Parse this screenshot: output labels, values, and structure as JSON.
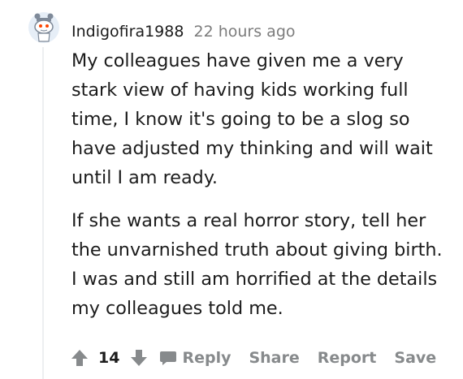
{
  "comment": {
    "username": "Indigofira1988",
    "timestamp": "22 hours ago",
    "paragraphs": [
      "My colleagues have given me a very stark view of having kids working full time, I know it's going to be a slog so have adjusted my thinking and will wait until I am ready.",
      "If she wants a real horror story, tell her the unvarnished truth about giving birth. I was and still am horrified at the details my colleagues told me."
    ],
    "score": "14",
    "actions": {
      "reply": "Reply",
      "share": "Share",
      "report": "Report",
      "save": "Save"
    }
  },
  "icons": {
    "avatar": "snoo-avatar-icon",
    "upvote": "upvote-arrow-icon",
    "downvote": "downvote-arrow-icon",
    "reply": "chat-bubble-icon"
  },
  "colors": {
    "text": "#1c1c1c",
    "muted": "#7c7c7c",
    "action": "#878a8c",
    "thread_line": "#edeff1",
    "avatar_bg": "#e6eef7"
  }
}
